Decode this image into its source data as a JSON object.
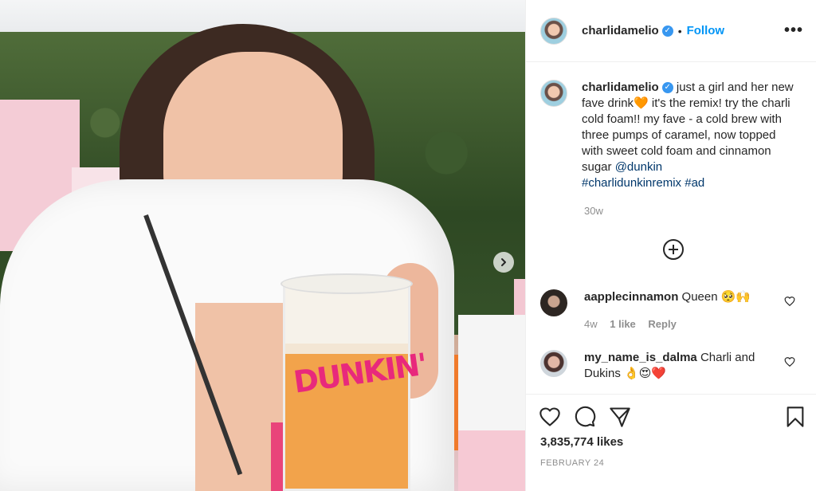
{
  "post": {
    "username": "charlidamelio",
    "verified_badge": "✓",
    "dot": "•",
    "follow_label": "Follow",
    "more_label": "•••"
  },
  "caption": {
    "username": "charlidamelio",
    "text": " just a girl and her new fave drink🧡 it's the remix! try the charli cold foam!! my fave - a cold brew with three pumps of caramel, now topped with sweet cold foam and cinnamon sugar ",
    "mention": "@dunkin",
    "hashtag1": "#charlidunkinremix",
    "hashtag2": "#ad",
    "time": "30w"
  },
  "photo": {
    "cup_logo": "DUNKIN'",
    "next_icon": "chevron-right-icon"
  },
  "add_comment_icon": "plus-circle-icon",
  "comments": [
    {
      "username": "aapplecinnamon",
      "text": "Queen 🥺🙌",
      "time": "4w",
      "likes": "1 like",
      "reply": "Reply"
    },
    {
      "username": "my_name_is_dalma",
      "text": "Charli and Dukins 👌😍❤️"
    }
  ],
  "engagement": {
    "likes": "3,835,774 likes",
    "date": "FEBRUARY 24"
  },
  "colors": {
    "accent": "#0095f6",
    "verified": "#3897f0",
    "text": "#262626",
    "muted": "#8e8e8e",
    "link": "#00376b"
  }
}
